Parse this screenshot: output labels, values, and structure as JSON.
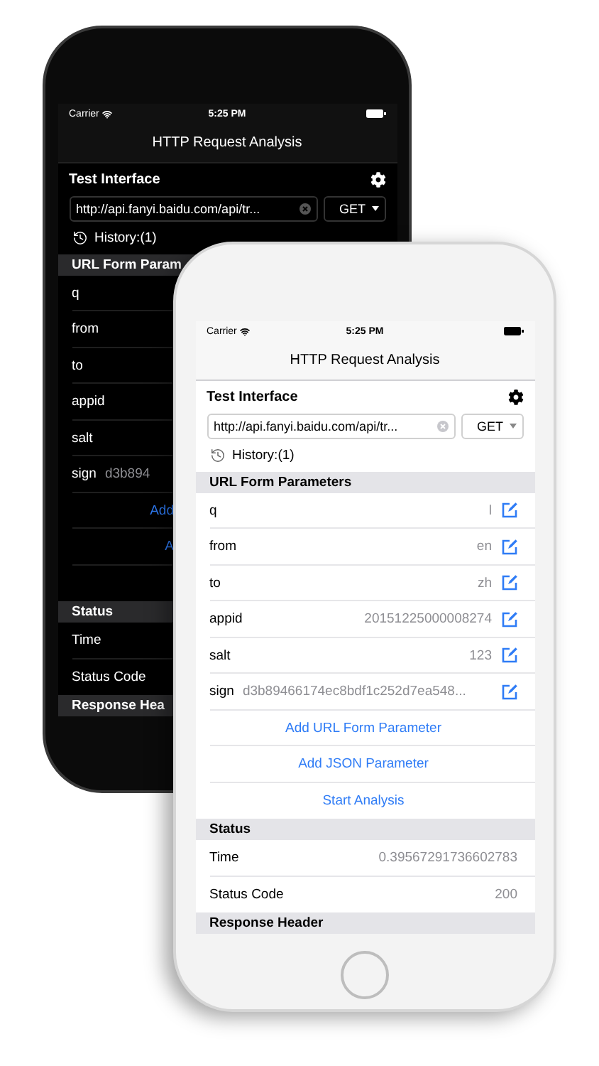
{
  "phones": [
    {
      "dark": true,
      "status_bar": {
        "carrier": "Carrier",
        "time": "5:25 PM"
      },
      "nav_title": "HTTP Request Analysis",
      "test_interface": {
        "title": "Test Interface",
        "url": "http://api.fanyi.baidu.com/api/tr...",
        "method": "GET",
        "history": "History:(1)"
      },
      "sections": [
        {
          "header": "URL Form Param",
          "rows": [
            {
              "kind": "param",
              "key": "q",
              "editable": false
            },
            {
              "kind": "param",
              "key": "from",
              "editable": false
            },
            {
              "kind": "param",
              "key": "to",
              "editable": false
            },
            {
              "kind": "param",
              "key": "appid",
              "editable": false
            },
            {
              "kind": "param",
              "key": "salt",
              "editable": false
            },
            {
              "kind": "param",
              "key": "sign",
              "value": "d3b894",
              "editable": false
            },
            {
              "kind": "action",
              "label": "Add"
            },
            {
              "kind": "action",
              "label": "A"
            },
            {
              "kind": "blank"
            }
          ]
        },
        {
          "header": "Status",
          "rows": [
            {
              "kind": "param",
              "key": "Time",
              "editable": false
            },
            {
              "kind": "param",
              "key": "Status Code",
              "editable": false
            }
          ]
        },
        {
          "header": "Response Hea"
        }
      ]
    },
    {
      "dark": false,
      "status_bar": {
        "carrier": "Carrier",
        "time": "5:25 PM"
      },
      "nav_title": "HTTP Request Analysis",
      "test_interface": {
        "title": "Test Interface",
        "url": "http://api.fanyi.baidu.com/api/tr...",
        "method": "GET",
        "history": "History:(1)"
      },
      "sections": [
        {
          "header": "URL Form Parameters",
          "rows": [
            {
              "kind": "param",
              "key": "q",
              "value": "l",
              "editable": true
            },
            {
              "kind": "param",
              "key": "from",
              "value": "en",
              "editable": true
            },
            {
              "kind": "param",
              "key": "to",
              "value": "zh",
              "editable": true
            },
            {
              "kind": "param",
              "key": "appid",
              "value": "20151225000008274",
              "editable": true
            },
            {
              "kind": "param",
              "key": "salt",
              "value": "123",
              "editable": true
            },
            {
              "kind": "param",
              "key": "sign",
              "value": "d3b89466174ec8bdf1c252d7ea548...",
              "editable": true
            },
            {
              "kind": "action",
              "label": "Add URL Form Parameter"
            },
            {
              "kind": "action",
              "label": "Add JSON Parameter"
            },
            {
              "kind": "action",
              "label": "Start Analysis"
            }
          ]
        },
        {
          "header": "Status",
          "rows": [
            {
              "kind": "param",
              "key": "Time",
              "value": "0.39567291736602783",
              "editable": false
            },
            {
              "kind": "param",
              "key": "Status Code",
              "value": "200",
              "editable": false
            }
          ]
        },
        {
          "header": "Response Header"
        }
      ]
    }
  ]
}
